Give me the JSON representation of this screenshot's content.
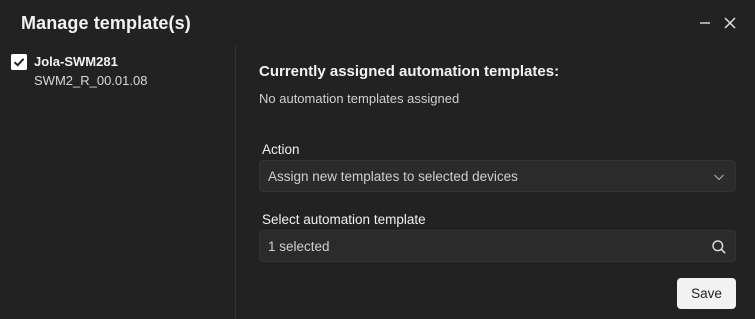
{
  "dialog": {
    "title": "Manage template(s)"
  },
  "devices": [
    {
      "name": "Jola-SWM281",
      "version": "SWM2_R_00.01.08",
      "checked": true
    }
  ],
  "assigned": {
    "heading": "Currently assigned automation templates:",
    "status": "No automation templates assigned"
  },
  "action": {
    "label": "Action",
    "value": "Assign new templates to selected devices"
  },
  "template_select": {
    "label": "Select automation template",
    "value": "1 selected"
  },
  "buttons": {
    "save": "Save"
  },
  "icons": {
    "minimize": "minimize-icon",
    "close": "close-icon",
    "checkbox": "checkmark-icon",
    "dropdown": "chevron-down-icon",
    "search": "search-icon"
  }
}
